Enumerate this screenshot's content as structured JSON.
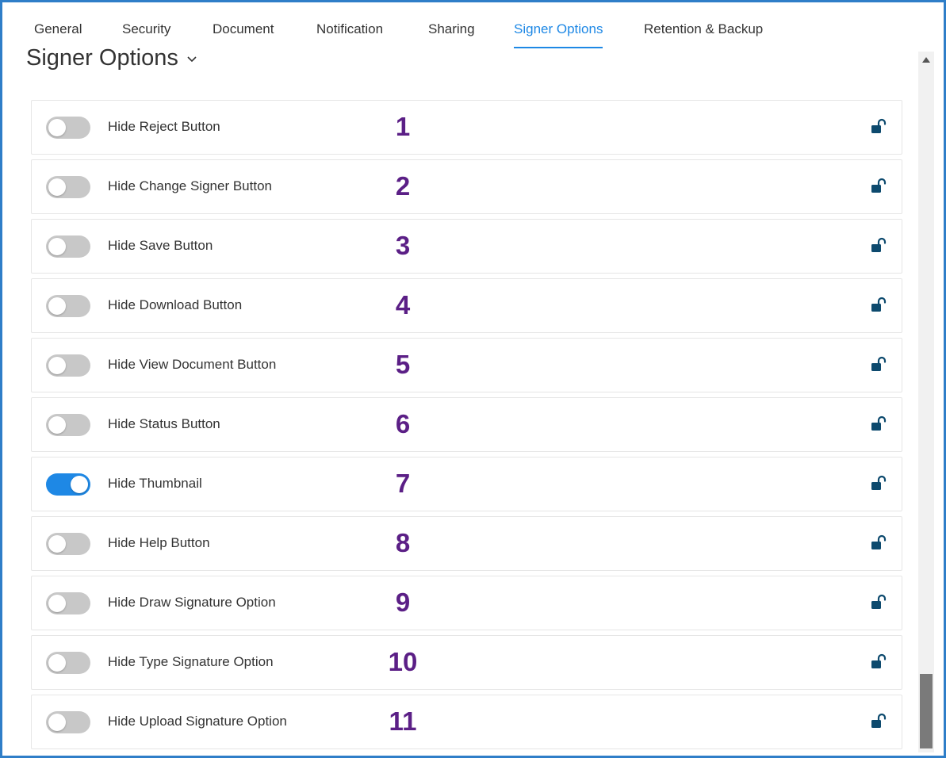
{
  "tabs": [
    {
      "label": "General",
      "active": false
    },
    {
      "label": "Security",
      "active": false
    },
    {
      "label": "Document",
      "active": false
    },
    {
      "label": "Notification",
      "active": false
    },
    {
      "label": "Sharing",
      "active": false
    },
    {
      "label": "Signer Options",
      "active": true
    },
    {
      "label": "Retention & Backup",
      "active": false
    }
  ],
  "section": {
    "title": "Signer Options",
    "chevron_icon": "chevron-down-icon"
  },
  "options": [
    {
      "label": "Hide Reject Button",
      "number": "1",
      "enabled": false,
      "lock_icon": "unlock-icon"
    },
    {
      "label": "Hide Change Signer Button",
      "number": "2",
      "enabled": false,
      "lock_icon": "unlock-icon"
    },
    {
      "label": "Hide Save Button",
      "number": "3",
      "enabled": false,
      "lock_icon": "unlock-icon"
    },
    {
      "label": "Hide Download Button",
      "number": "4",
      "enabled": false,
      "lock_icon": "unlock-icon"
    },
    {
      "label": "Hide View Document Button",
      "number": "5",
      "enabled": false,
      "lock_icon": "unlock-icon"
    },
    {
      "label": "Hide Status Button",
      "number": "6",
      "enabled": false,
      "lock_icon": "unlock-icon"
    },
    {
      "label": "Hide Thumbnail",
      "number": "7",
      "enabled": true,
      "lock_icon": "unlock-icon"
    },
    {
      "label": "Hide Help Button",
      "number": "8",
      "enabled": false,
      "lock_icon": "unlock-icon"
    },
    {
      "label": "Hide Draw Signature Option",
      "number": "9",
      "enabled": false,
      "lock_icon": "unlock-icon"
    },
    {
      "label": "Hide Type Signature Option",
      "number": "10",
      "enabled": false,
      "lock_icon": "unlock-icon"
    },
    {
      "label": "Hide Upload Signature Option",
      "number": "11",
      "enabled": false,
      "lock_icon": "unlock-icon"
    }
  ],
  "colors": {
    "accent": "#1e88e5",
    "frame_border": "#2f7ec8",
    "number_annotation": "#5b1f86",
    "lock_icon": "#0d4a6e",
    "toggle_off": "#c8c8c8"
  }
}
